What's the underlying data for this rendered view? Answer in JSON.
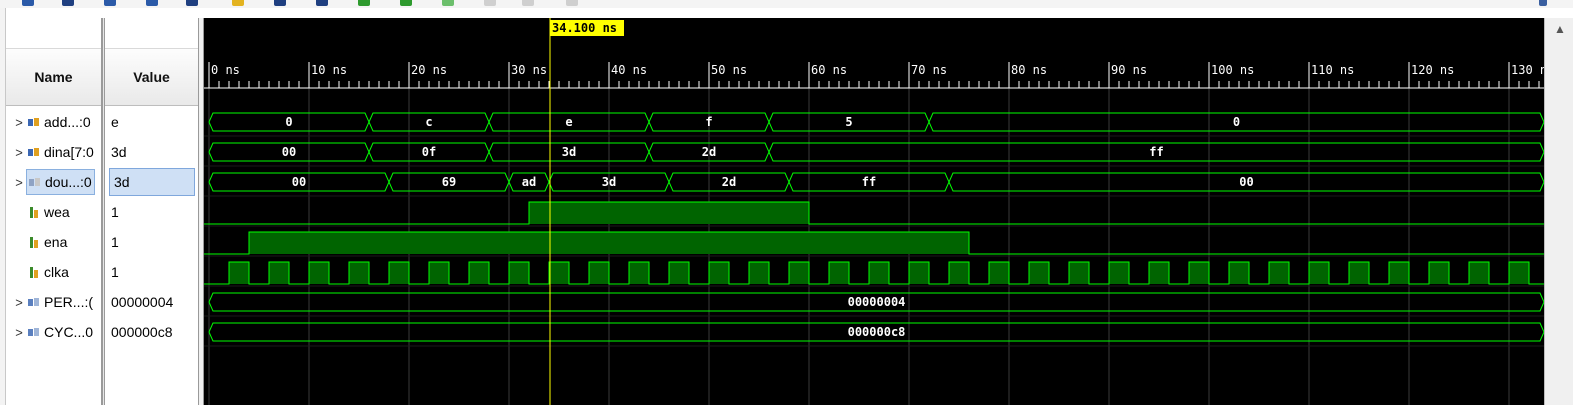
{
  "columns": {
    "name": "Name",
    "value": "Value"
  },
  "signals": [
    {
      "name": "add...:0",
      "value": "e",
      "kind": "bus",
      "expandable": true,
      "icon": "bus-signal-icon"
    },
    {
      "name": "dina[7:0",
      "value": "3d",
      "kind": "bus",
      "expandable": true,
      "icon": "bus-signal-icon"
    },
    {
      "name": "dou...:0",
      "value": "3d",
      "kind": "bus",
      "expandable": true,
      "selected": true,
      "icon": "output-bus-icon"
    },
    {
      "name": "wea",
      "value": "1",
      "kind": "bit",
      "expandable": false,
      "icon": "bit-signal-icon"
    },
    {
      "name": "ena",
      "value": "1",
      "kind": "bit",
      "expandable": false,
      "icon": "bit-signal-icon"
    },
    {
      "name": "clka",
      "value": "1",
      "kind": "bit",
      "expandable": false,
      "icon": "bit-signal-icon"
    },
    {
      "name": "PER...:(",
      "value": "00000004",
      "kind": "param",
      "expandable": true,
      "icon": "parameter-icon"
    },
    {
      "name": "CYC...0",
      "value": "000000c8",
      "kind": "param",
      "expandable": true,
      "icon": "parameter-icon"
    }
  ],
  "cursor": {
    "time_ns": 34.1,
    "label": "34.100 ns",
    "color": "#ffff00"
  },
  "time_axis": {
    "unit": "ns",
    "labels": [
      "0 ns",
      "10 ns",
      "20 ns",
      "30 ns",
      "40 ns",
      "50 ns",
      "60 ns",
      "70 ns",
      "80 ns",
      "90 ns",
      "100 ns",
      "110 ns",
      "120 ns",
      "130 n"
    ],
    "start_ns": 0,
    "step_ns": 10
  },
  "waveforms": {
    "addra": [
      {
        "start": 0,
        "end": 16,
        "value": "0"
      },
      {
        "start": 16,
        "end": 28,
        "value": "c"
      },
      {
        "start": 28,
        "end": 44,
        "value": "e"
      },
      {
        "start": 44,
        "end": 56,
        "value": "f"
      },
      {
        "start": 56,
        "end": 72,
        "value": "5"
      },
      {
        "start": 72,
        "end": 134,
        "value": "0"
      }
    ],
    "dina": [
      {
        "start": 0,
        "end": 16,
        "value": "00"
      },
      {
        "start": 16,
        "end": 28,
        "value": "0f"
      },
      {
        "start": 28,
        "end": 44,
        "value": "3d"
      },
      {
        "start": 44,
        "end": 56,
        "value": "2d"
      },
      {
        "start": 56,
        "end": 134,
        "value": "ff"
      }
    ],
    "douta": [
      {
        "start": 0,
        "end": 18,
        "value": "00"
      },
      {
        "start": 18,
        "end": 30,
        "value": "69"
      },
      {
        "start": 30,
        "end": 34,
        "value": "ad"
      },
      {
        "start": 34,
        "end": 46,
        "value": "3d"
      },
      {
        "start": 46,
        "end": 58,
        "value": "2d"
      },
      {
        "start": 58,
        "end": 74,
        "value": "ff"
      },
      {
        "start": 74,
        "end": 134,
        "value": "00"
      }
    ],
    "wea": [
      {
        "high_from": 32,
        "high_to": 60
      }
    ],
    "ena": [
      {
        "high_from": 4,
        "high_to": 76
      }
    ],
    "clka": {
      "period_ns": 4,
      "first_rise_ns": 2
    },
    "PER": [
      {
        "start": 0,
        "end": 134,
        "value": "00000004"
      }
    ],
    "CYC": [
      {
        "start": 0,
        "end": 134,
        "value": "000000c8"
      }
    ]
  },
  "colors": {
    "wave": "#00ff00",
    "fill_high": "#006400",
    "grid": "#3a3a3a",
    "background": "#000000",
    "cursor": "#ffff00"
  },
  "icons": [
    "expand-arrow-icon",
    "bus-signal-icon",
    "bit-signal-icon",
    "parameter-icon",
    "scroll-up-icon"
  ]
}
